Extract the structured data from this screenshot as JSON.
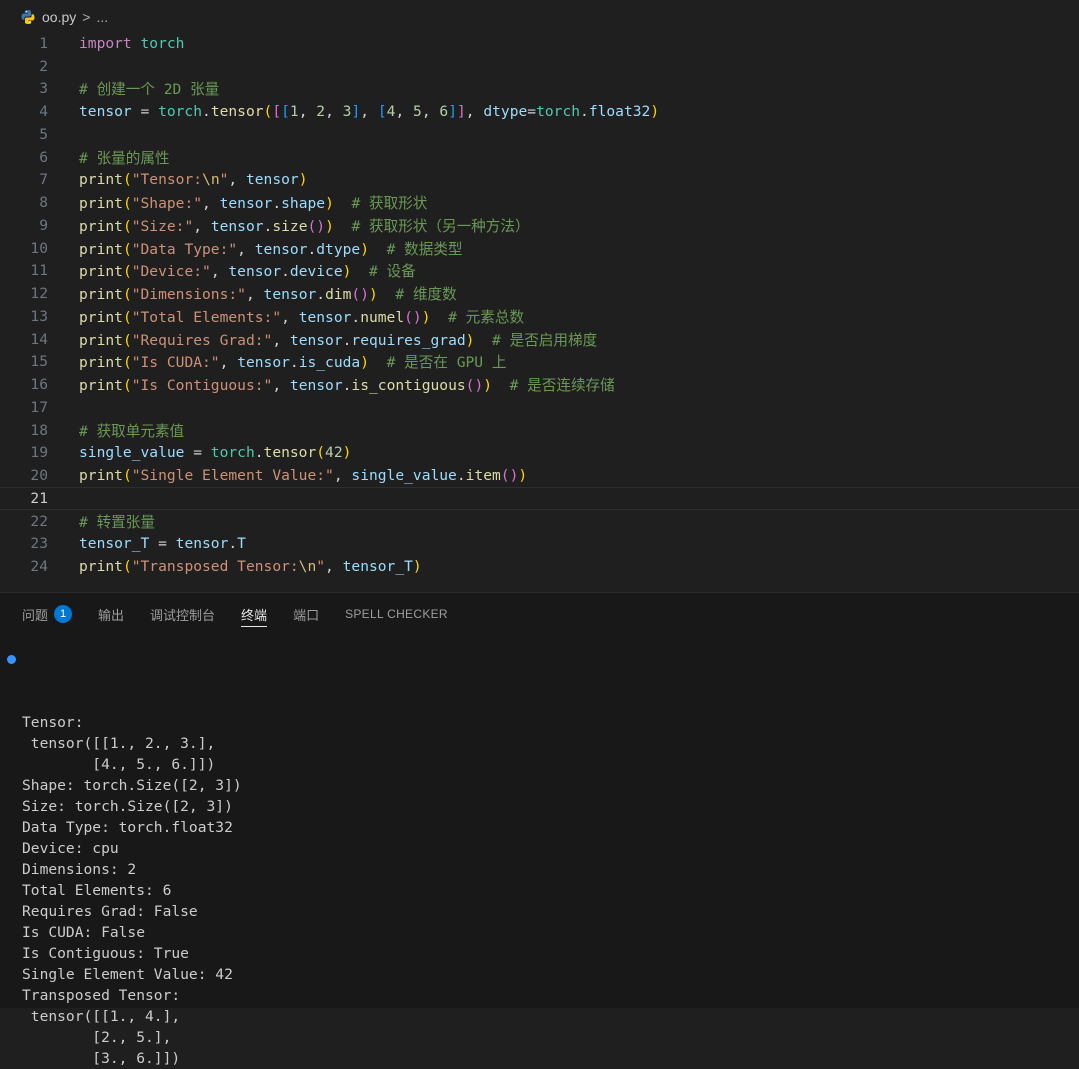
{
  "breadcrumb": {
    "file": "oo.py",
    "separator": ">",
    "more": "..."
  },
  "editor": {
    "current_line": 21,
    "lines": [
      {
        "n": "1",
        "tokens": [
          [
            "kw",
            "import"
          ],
          [
            "txt",
            " "
          ],
          [
            "mod",
            "torch"
          ]
        ]
      },
      {
        "n": "2",
        "tokens": []
      },
      {
        "n": "3",
        "tokens": [
          [
            "cmt",
            "# 创建一个 2D 张量"
          ]
        ]
      },
      {
        "n": "4",
        "tokens": [
          [
            "var",
            "tensor"
          ],
          [
            "txt",
            " = "
          ],
          [
            "mod",
            "torch"
          ],
          [
            "txt",
            "."
          ],
          [
            "fn",
            "tensor"
          ],
          [
            "b1",
            "("
          ],
          [
            "b2",
            "["
          ],
          [
            "b3",
            "["
          ],
          [
            "num",
            "1"
          ],
          [
            "txt",
            ", "
          ],
          [
            "num",
            "2"
          ],
          [
            "txt",
            ", "
          ],
          [
            "num",
            "3"
          ],
          [
            "b3",
            "]"
          ],
          [
            "txt",
            ", "
          ],
          [
            "b3",
            "["
          ],
          [
            "num",
            "4"
          ],
          [
            "txt",
            ", "
          ],
          [
            "num",
            "5"
          ],
          [
            "txt",
            ", "
          ],
          [
            "num",
            "6"
          ],
          [
            "b3",
            "]"
          ],
          [
            "b2",
            "]"
          ],
          [
            "txt",
            ", "
          ],
          [
            "var",
            "dtype"
          ],
          [
            "txt",
            "="
          ],
          [
            "mod",
            "torch"
          ],
          [
            "txt",
            "."
          ],
          [
            "var",
            "float32"
          ],
          [
            "b1",
            ")"
          ]
        ]
      },
      {
        "n": "5",
        "tokens": []
      },
      {
        "n": "6",
        "tokens": [
          [
            "cmt",
            "# 张量的属性"
          ]
        ]
      },
      {
        "n": "7",
        "tokens": [
          [
            "fn",
            "print"
          ],
          [
            "b1",
            "("
          ],
          [
            "str",
            "\"Tensor:"
          ],
          [
            "esc",
            "\\n"
          ],
          [
            "str",
            "\""
          ],
          [
            "txt",
            ", "
          ],
          [
            "var",
            "tensor"
          ],
          [
            "b1",
            ")"
          ]
        ]
      },
      {
        "n": "8",
        "tokens": [
          [
            "fn",
            "print"
          ],
          [
            "b1",
            "("
          ],
          [
            "str",
            "\"Shape:\""
          ],
          [
            "txt",
            ", "
          ],
          [
            "var",
            "tensor"
          ],
          [
            "txt",
            "."
          ],
          [
            "var",
            "shape"
          ],
          [
            "b1",
            ")"
          ],
          [
            "txt",
            "  "
          ],
          [
            "cmt",
            "# 获取形状"
          ]
        ]
      },
      {
        "n": "9",
        "tokens": [
          [
            "fn",
            "print"
          ],
          [
            "b1",
            "("
          ],
          [
            "str",
            "\"Size:\""
          ],
          [
            "txt",
            ", "
          ],
          [
            "var",
            "tensor"
          ],
          [
            "txt",
            "."
          ],
          [
            "fn",
            "size"
          ],
          [
            "b2",
            "()"
          ],
          [
            "b1",
            ")"
          ],
          [
            "txt",
            "  "
          ],
          [
            "cmt",
            "# 获取形状（另一种方法）"
          ]
        ]
      },
      {
        "n": "10",
        "tokens": [
          [
            "fn",
            "print"
          ],
          [
            "b1",
            "("
          ],
          [
            "str",
            "\"Data Type:\""
          ],
          [
            "txt",
            ", "
          ],
          [
            "var",
            "tensor"
          ],
          [
            "txt",
            "."
          ],
          [
            "var",
            "dtype"
          ],
          [
            "b1",
            ")"
          ],
          [
            "txt",
            "  "
          ],
          [
            "cmt",
            "# 数据类型"
          ]
        ]
      },
      {
        "n": "11",
        "tokens": [
          [
            "fn",
            "print"
          ],
          [
            "b1",
            "("
          ],
          [
            "str",
            "\"Device:\""
          ],
          [
            "txt",
            ", "
          ],
          [
            "var",
            "tensor"
          ],
          [
            "txt",
            "."
          ],
          [
            "var",
            "device"
          ],
          [
            "b1",
            ")"
          ],
          [
            "txt",
            "  "
          ],
          [
            "cmt",
            "# 设备"
          ]
        ]
      },
      {
        "n": "12",
        "tokens": [
          [
            "fn",
            "print"
          ],
          [
            "b1",
            "("
          ],
          [
            "str",
            "\"Dimensions:\""
          ],
          [
            "txt",
            ", "
          ],
          [
            "var",
            "tensor"
          ],
          [
            "txt",
            "."
          ],
          [
            "fn",
            "dim"
          ],
          [
            "b2",
            "()"
          ],
          [
            "b1",
            ")"
          ],
          [
            "txt",
            "  "
          ],
          [
            "cmt",
            "# 维度数"
          ]
        ]
      },
      {
        "n": "13",
        "tokens": [
          [
            "fn",
            "print"
          ],
          [
            "b1",
            "("
          ],
          [
            "str",
            "\"Total Elements:\""
          ],
          [
            "txt",
            ", "
          ],
          [
            "var",
            "tensor"
          ],
          [
            "txt",
            "."
          ],
          [
            "fn",
            "numel"
          ],
          [
            "b2",
            "()"
          ],
          [
            "b1",
            ")"
          ],
          [
            "txt",
            "  "
          ],
          [
            "cmt",
            "# 元素总数"
          ]
        ]
      },
      {
        "n": "14",
        "tokens": [
          [
            "fn",
            "print"
          ],
          [
            "b1",
            "("
          ],
          [
            "str",
            "\"Requires Grad:\""
          ],
          [
            "txt",
            ", "
          ],
          [
            "var",
            "tensor"
          ],
          [
            "txt",
            "."
          ],
          [
            "var",
            "requires_grad"
          ],
          [
            "b1",
            ")"
          ],
          [
            "txt",
            "  "
          ],
          [
            "cmt",
            "# 是否启用梯度"
          ]
        ]
      },
      {
        "n": "15",
        "tokens": [
          [
            "fn",
            "print"
          ],
          [
            "b1",
            "("
          ],
          [
            "str",
            "\"Is CUDA:\""
          ],
          [
            "txt",
            ", "
          ],
          [
            "var",
            "tensor"
          ],
          [
            "txt",
            "."
          ],
          [
            "var",
            "is_cuda"
          ],
          [
            "b1",
            ")"
          ],
          [
            "txt",
            "  "
          ],
          [
            "cmt",
            "# 是否在 GPU 上"
          ]
        ]
      },
      {
        "n": "16",
        "tokens": [
          [
            "fn",
            "print"
          ],
          [
            "b1",
            "("
          ],
          [
            "str",
            "\"Is Contiguous:\""
          ],
          [
            "txt",
            ", "
          ],
          [
            "var",
            "tensor"
          ],
          [
            "txt",
            "."
          ],
          [
            "fn",
            "is_contiguous"
          ],
          [
            "b2",
            "()"
          ],
          [
            "b1",
            ")"
          ],
          [
            "txt",
            "  "
          ],
          [
            "cmt",
            "# 是否连续存储"
          ]
        ]
      },
      {
        "n": "17",
        "tokens": []
      },
      {
        "n": "18",
        "tokens": [
          [
            "cmt",
            "# 获取单元素值"
          ]
        ]
      },
      {
        "n": "19",
        "tokens": [
          [
            "var",
            "single_value"
          ],
          [
            "txt",
            " = "
          ],
          [
            "mod",
            "torch"
          ],
          [
            "txt",
            "."
          ],
          [
            "fn",
            "tensor"
          ],
          [
            "b1",
            "("
          ],
          [
            "num",
            "42"
          ],
          [
            "b1",
            ")"
          ]
        ]
      },
      {
        "n": "20",
        "tokens": [
          [
            "fn",
            "print"
          ],
          [
            "b1",
            "("
          ],
          [
            "str",
            "\"Single Element Value:\""
          ],
          [
            "txt",
            ", "
          ],
          [
            "var",
            "single_value"
          ],
          [
            "txt",
            "."
          ],
          [
            "fn",
            "item"
          ],
          [
            "b2",
            "()"
          ],
          [
            "b1",
            ")"
          ]
        ]
      },
      {
        "n": "21",
        "tokens": []
      },
      {
        "n": "22",
        "tokens": [
          [
            "cmt",
            "# 转置张量"
          ]
        ]
      },
      {
        "n": "23",
        "tokens": [
          [
            "var",
            "tensor_T"
          ],
          [
            "txt",
            " = "
          ],
          [
            "var",
            "tensor"
          ],
          [
            "txt",
            "."
          ],
          [
            "var",
            "T"
          ]
        ]
      },
      {
        "n": "24",
        "tokens": [
          [
            "fn",
            "print"
          ],
          [
            "b1",
            "("
          ],
          [
            "str",
            "\"Transposed Tensor:"
          ],
          [
            "esc",
            "\\n"
          ],
          [
            "str",
            "\""
          ],
          [
            "txt",
            ", "
          ],
          [
            "var",
            "tensor_T"
          ],
          [
            "b1",
            ")"
          ]
        ]
      }
    ]
  },
  "panel": {
    "tabs": [
      {
        "id": "problems",
        "label": "问题",
        "badge": "1"
      },
      {
        "id": "output",
        "label": "输出"
      },
      {
        "id": "debug-console",
        "label": "调试控制台"
      },
      {
        "id": "terminal",
        "label": "终端",
        "active": true
      },
      {
        "id": "ports",
        "label": "端口"
      },
      {
        "id": "spell-checker",
        "label": "SPELL CHECKER"
      }
    ],
    "terminal_lines": [
      "Tensor:",
      " tensor([[1., 2., 3.],",
      "        [4., 5., 6.]])",
      "Shape: torch.Size([2, 3])",
      "Size: torch.Size([2, 3])",
      "Data Type: torch.float32",
      "Device: cpu",
      "Dimensions: 2",
      "Total Elements: 6",
      "Requires Grad: False",
      "Is CUDA: False",
      "Is Contiguous: True",
      "Single Element Value: 42",
      "Transposed Tensor:",
      " tensor([[1., 4.],",
      "        [2., 5.],",
      "        [3., 6.]])"
    ]
  }
}
